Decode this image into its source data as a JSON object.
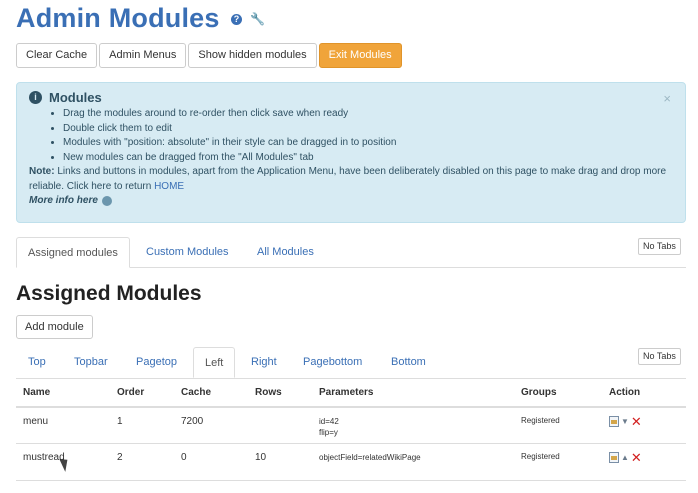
{
  "page": {
    "title": "Admin Modules"
  },
  "toolbar": {
    "clear_cache": "Clear Cache",
    "admin_menus": "Admin Menus",
    "show_hidden": "Show hidden modules",
    "exit_modules": "Exit Modules"
  },
  "alert": {
    "title": "Modules",
    "close": "×",
    "items": [
      "Drag the modules around to re-order then click save when ready",
      "Double click them to edit",
      "Modules with \"position: absolute\" in their style can be dragged in to position",
      "New modules can be dragged from the \"All Modules\" tab"
    ],
    "note_label": "Note:",
    "note_text": "Links and buttons in modules, apart from the Application Menu, have been deliberately disabled on this page to make drag and drop more reliable. Click here to return",
    "home_link": "HOME",
    "more_info": "More info here"
  },
  "main_tabs": {
    "assigned": "Assigned modules",
    "custom": "Custom Modules",
    "all": "All Modules",
    "no_tabs": "No Tabs"
  },
  "section": {
    "title": "Assigned Modules",
    "add_module": "Add module"
  },
  "position_tabs": {
    "items": [
      "Top",
      "Topbar",
      "Pagetop",
      "Left",
      "Right",
      "Pagebottom",
      "Bottom"
    ],
    "active": "Left",
    "no_tabs": "No Tabs"
  },
  "table": {
    "headers": [
      "Name",
      "Order",
      "Cache",
      "Rows",
      "Parameters",
      "Groups",
      "Action"
    ],
    "rows": [
      {
        "name": "menu",
        "order": "1",
        "cache": "7200",
        "rows": "",
        "params_line1": "id=42",
        "params_line2": "flip=y",
        "groups": "Registered"
      },
      {
        "name": "mustread",
        "order": "2",
        "cache": "0",
        "rows": "10",
        "params_line1": "objectField=relatedWikiPage",
        "params_line2": "",
        "groups": "Registered"
      }
    ]
  },
  "colors": {
    "link": "#3a6fb5",
    "warning_button": "#f0a43a",
    "alert_background": "#d7ebf3",
    "delete": "#d21f1f"
  }
}
